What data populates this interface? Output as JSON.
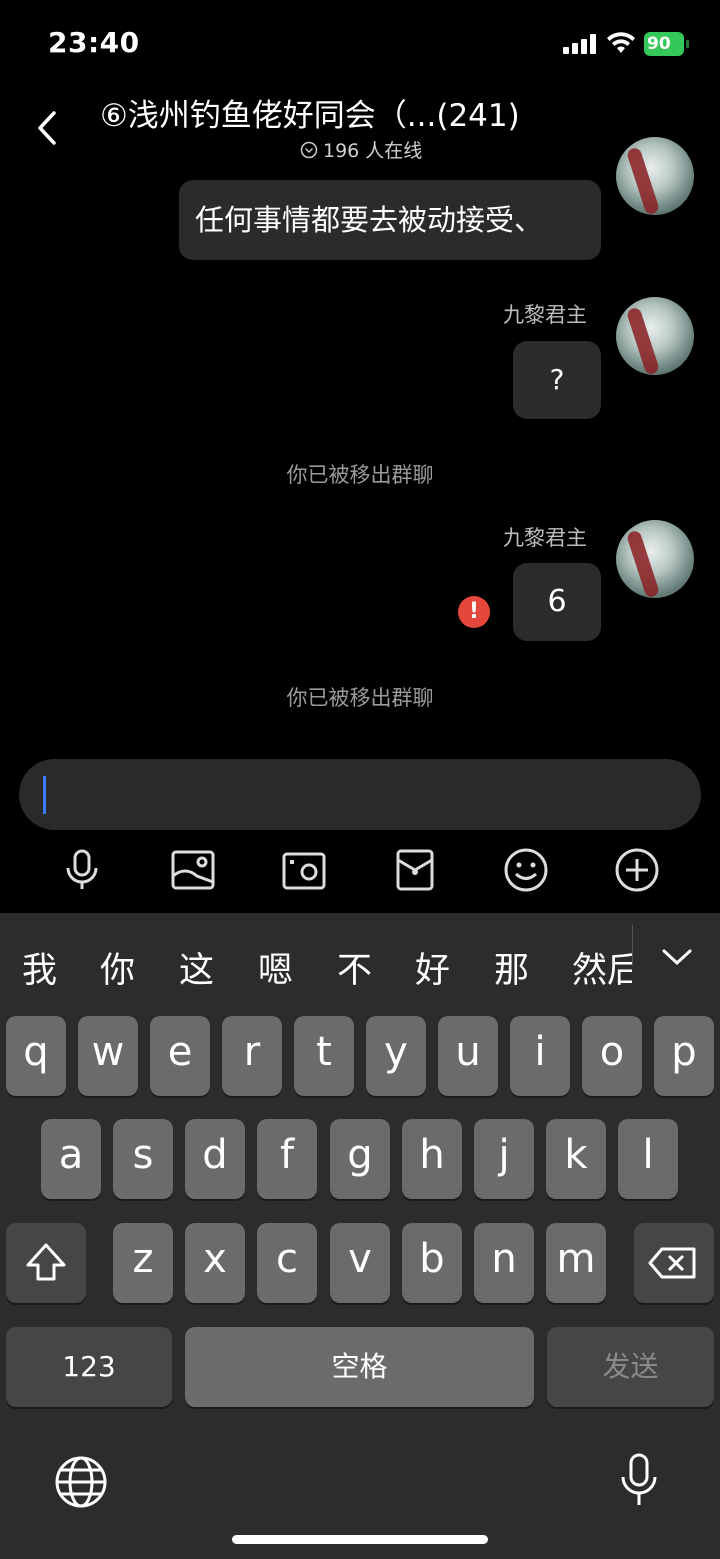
{
  "status": {
    "time": "23:40",
    "battery": "90"
  },
  "header": {
    "title": "⑥浅州钓鱼佬好同会（...(241)",
    "online": "196 人在线"
  },
  "messages": {
    "m1": {
      "text": "任何事情都要去被动接受、"
    },
    "m2": {
      "sender": "九黎君主",
      "text": "?"
    },
    "sys1": {
      "text": "你已被移出群聊"
    },
    "m3": {
      "sender": "九黎君主",
      "text": "6",
      "status": "send-failed"
    },
    "sys2": {
      "text": "你已被移出群聊"
    }
  },
  "input": {
    "value": ""
  },
  "toolbar": {
    "icons": [
      "mic-icon",
      "image-icon",
      "camera-icon",
      "red-packet-icon",
      "emoji-icon",
      "plus-icon"
    ]
  },
  "keyboard": {
    "candidates": [
      "我",
      "你",
      "这",
      "嗯",
      "不",
      "好",
      "那",
      "然后"
    ],
    "row1": [
      "q",
      "w",
      "e",
      "r",
      "t",
      "y",
      "u",
      "i",
      "o",
      "p"
    ],
    "row2": [
      "a",
      "s",
      "d",
      "f",
      "g",
      "h",
      "j",
      "k",
      "l"
    ],
    "row3": [
      "z",
      "x",
      "c",
      "v",
      "b",
      "n",
      "m"
    ],
    "numbers": "123",
    "space": "空格",
    "send": "发送"
  },
  "colors": {
    "accent": "#3a7bff",
    "battery": "#35c759",
    "error": "#e6473d",
    "bubble": "#2b2b2b"
  }
}
